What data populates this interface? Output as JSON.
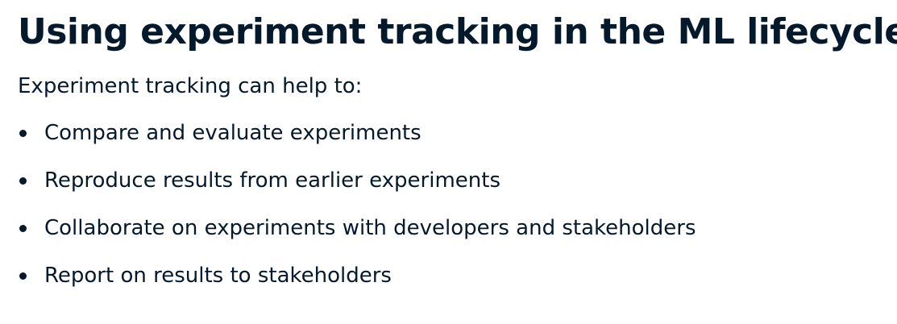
{
  "slide": {
    "title": "Using experiment tracking in the ML lifecycle",
    "intro": "Experiment tracking can help to:",
    "bullets": [
      "Compare and evaluate experiments",
      "Reproduce results from earlier experiments",
      "Collaborate on experiments with developers and stakeholders",
      "Report on results to stakeholders"
    ]
  },
  "colors": {
    "text": "#05192d",
    "background": "#ffffff"
  }
}
